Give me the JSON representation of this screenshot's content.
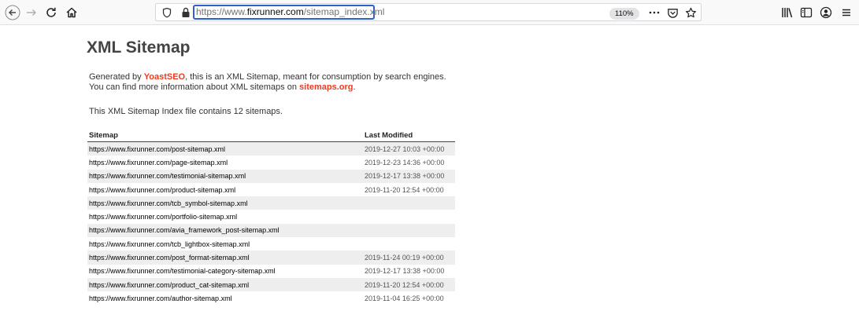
{
  "browser": {
    "url_prefix": "https://www.",
    "url_host": "fixrunner.com",
    "url_path": "/sitemap_index.xml",
    "zoom": "110%",
    "icons": {
      "back": "back-arrow-icon",
      "forward": "forward-arrow-icon",
      "reload": "reload-icon",
      "home": "home-icon",
      "tracking": "shield-icon",
      "lock": "lock-icon",
      "page_actions": "more-icon",
      "pocket": "pocket-icon",
      "bookmark": "star-icon",
      "library": "library-icon",
      "sidebar": "sidebar-icon",
      "account": "account-icon",
      "menu": "hamburger-menu-icon"
    }
  },
  "page": {
    "title": "XML Sitemap",
    "desc_prefix": "Generated by ",
    "desc_brand": "YoastSEO",
    "desc_mid": ", this is an XML Sitemap, meant for consumption by search engines.",
    "desc_line2": "You can find more information about XML sitemaps on ",
    "desc_link": "sitemaps.org",
    "desc_end": ".",
    "count_text": "This XML Sitemap Index file contains 12 sitemaps.",
    "brand_color": "#ee3b1f"
  },
  "table": {
    "headers": {
      "sitemap": "Sitemap",
      "modified": "Last Modified"
    },
    "rows": [
      {
        "url": "https://www.fixrunner.com/post-sitemap.xml",
        "modified": "2019-12-27 10:03 +00:00"
      },
      {
        "url": "https://www.fixrunner.com/page-sitemap.xml",
        "modified": "2019-12-23 14:36 +00:00"
      },
      {
        "url": "https://www.fixrunner.com/testimonial-sitemap.xml",
        "modified": "2019-12-17 13:38 +00:00"
      },
      {
        "url": "https://www.fixrunner.com/product-sitemap.xml",
        "modified": "2019-11-20 12:54 +00:00"
      },
      {
        "url": "https://www.fixrunner.com/tcb_symbol-sitemap.xml",
        "modified": ""
      },
      {
        "url": "https://www.fixrunner.com/portfolio-sitemap.xml",
        "modified": ""
      },
      {
        "url": "https://www.fixrunner.com/avia_framework_post-sitemap.xml",
        "modified": ""
      },
      {
        "url": "https://www.fixrunner.com/tcb_lightbox-sitemap.xml",
        "modified": ""
      },
      {
        "url": "https://www.fixrunner.com/post_format-sitemap.xml",
        "modified": "2019-11-24 00:19 +00:00"
      },
      {
        "url": "https://www.fixrunner.com/testimonial-category-sitemap.xml",
        "modified": "2019-12-17 13:38 +00:00"
      },
      {
        "url": "https://www.fixrunner.com/product_cat-sitemap.xml",
        "modified": "2019-11-20 12:54 +00:00"
      },
      {
        "url": "https://www.fixrunner.com/author-sitemap.xml",
        "modified": "2019-11-04 16:25 +00:00"
      }
    ]
  }
}
